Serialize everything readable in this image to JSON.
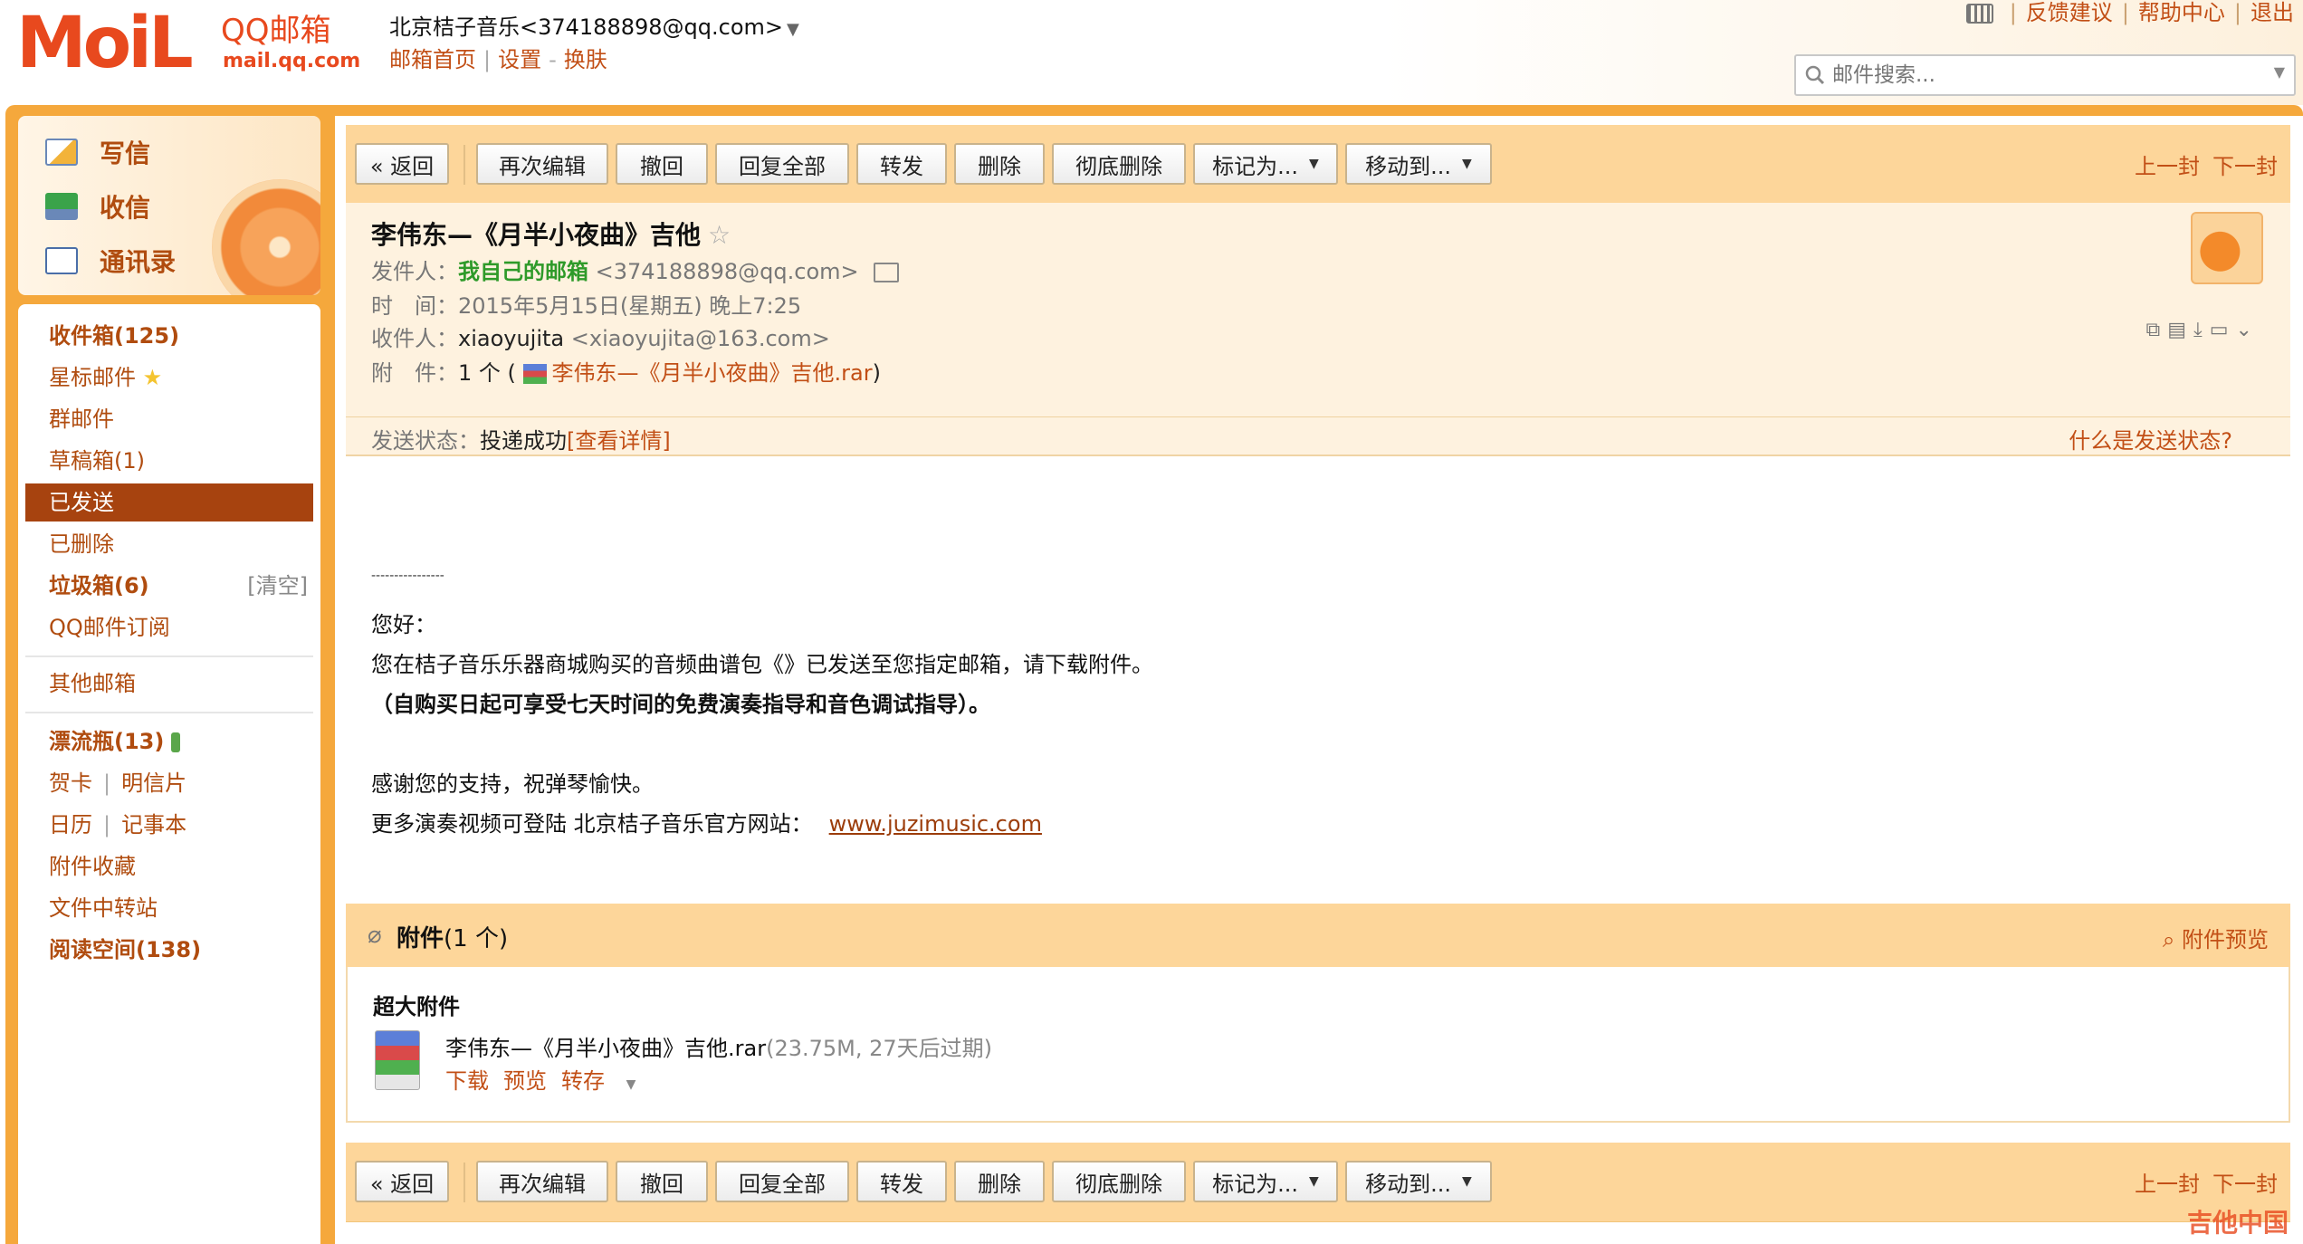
{
  "header": {
    "logo_mail": "MoiL",
    "logo_brand": "QQ邮箱",
    "logo_domain": "mail.qq.com",
    "account": "北京桔子音乐<374188898@qq.com>",
    "account_caret": "▼",
    "links": {
      "home": "邮箱首页",
      "settings": "设置",
      "dash": "-",
      "skin": "换肤"
    },
    "top_links": {
      "feedback": "反馈建议",
      "help": "帮助中心",
      "logout": "退出"
    },
    "search_placeholder": "邮件搜索..."
  },
  "sidebar": {
    "quick": {
      "write": "写信",
      "inbox": "收信",
      "contacts": "通讯录"
    },
    "folders": {
      "inbox": "收件箱(125)",
      "starred": "星标邮件",
      "group": "群邮件",
      "drafts": "草稿箱(1)",
      "sent": "已发送",
      "deleted": "已删除",
      "spam": "垃圾箱(6)",
      "spam_clear": "[清空]",
      "subscribe": "QQ邮件订阅",
      "other": "其他邮箱",
      "bottle": "漂流瓶(13)",
      "greeting": "贺卡",
      "postcard": "明信片",
      "calendar": "日历",
      "notes": "记事本",
      "attach_fav": "附件收藏",
      "transfer": "文件中转站",
      "reading": "阅读空间(138)"
    }
  },
  "toolbar": {
    "back": "« 返回",
    "reedit": "再次编辑",
    "recall": "撤回",
    "reply_all": "回复全部",
    "forward": "转发",
    "delete": "删除",
    "purge": "彻底删除",
    "mark_as": "标记为...",
    "move_to": "移动到...",
    "prev": "上一封",
    "next": "下一封"
  },
  "mail": {
    "subject": "李伟东—《月半小夜曲》吉他",
    "star": "☆",
    "from_label": "发件人：",
    "from_name": "我自己的邮箱",
    "from_addr": "<374188898@qq.com>",
    "time_label": "时　间：",
    "time": "2015年5月15日(星期五) 晚上7:25",
    "to_label": "收件人：",
    "to_name": "xiaoyujita",
    "to_addr": "<xiaoyujita@163.com>",
    "att_label": "附　件：",
    "att_count": "1 个 (",
    "att_name": "李伟东—《月半小夜曲》吉他.rar",
    "att_close": ")",
    "status_label": "发送状态：",
    "status_value": "投递成功",
    "status_detail": "[查看详情]",
    "status_help": "什么是发送状态?",
    "ops_icons": "⧉▤⤓▭⌄"
  },
  "body": {
    "divider": "----------------",
    "greeting": "您好：",
    "line1": "您在桔子音乐乐器商城购买的音频曲谱包《》已发送至您指定邮箱，请下载附件。",
    "line2": "（自购买日起可享受七天时间的免费演奏指导和音色调试指导）。",
    "line3": "感谢您的支持，祝弹琴愉快。",
    "line4": "更多演奏视频可登陆 北京桔子音乐官方网站：",
    "url": "www.juzimusic.com"
  },
  "attachments": {
    "title": "附件",
    "count": "(1 个)",
    "preview_label": "附件预览",
    "section": "超大附件",
    "file_name": "李伟东—《月半小夜曲》吉他.rar",
    "file_meta": "(23.75M, 27天后过期)",
    "download": "下载",
    "preview": "预览",
    "save": "转存"
  },
  "watermark": "吉他中国",
  "colors": {
    "accent": "#f5a83c",
    "link": "#c24f16",
    "active_nav": "#a7430f",
    "toolbar_bg": "#fdd69a",
    "header_bg": "#fef2df"
  }
}
